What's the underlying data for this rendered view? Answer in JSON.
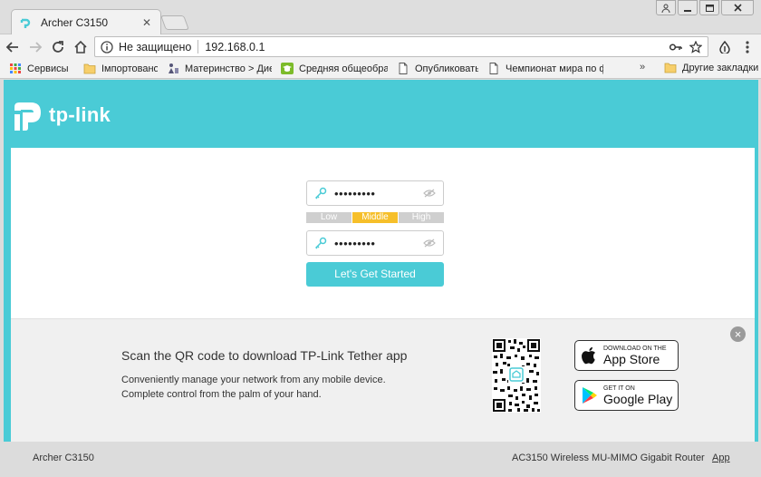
{
  "browser": {
    "tab_title": "Archer C3150",
    "security_label": "Не защищено",
    "url": "192.168.0.1",
    "bookmarks": [
      {
        "label": "Сервисы",
        "icon": "apps-grid-icon"
      },
      {
        "label": "Імпортовано",
        "icon": "folder-icon"
      },
      {
        "label": "Материнство > Диета",
        "icon": "site-favicon-icon"
      },
      {
        "label": "Средняя общеобразов",
        "icon": "graduation-cap-icon"
      },
      {
        "label": "Опубликовать",
        "icon": "page-icon"
      },
      {
        "label": "Чемпионат мира по ф",
        "icon": "page-icon"
      }
    ],
    "bookmarks_more": "»",
    "other_bookmarks": "Другие закладки"
  },
  "page": {
    "brand": "tp-link",
    "password_mask": "•••••••••",
    "confirm_mask": "•••••••••",
    "strength": {
      "low": "Low",
      "middle": "Middle",
      "high": "High",
      "active": "middle"
    },
    "start_button": "Let's Get Started",
    "app": {
      "title": "Scan the QR code to download TP-Link Tether app",
      "desc_line1": "Conveniently manage your network from any mobile device.",
      "desc_line2": "Complete control from the palm of your hand.",
      "appstore_small": "Download on the",
      "appstore_big": "App Store",
      "googleplay_small": "GET IT ON",
      "googleplay_big": "Google Play"
    },
    "footer": {
      "model": "Archer C3150",
      "description": "AC3150 Wireless MU-MIMO Gigabit Router",
      "app_link": "App"
    }
  },
  "colors": {
    "accent": "#4acbd6",
    "strength_active": "#f6bf2a"
  }
}
